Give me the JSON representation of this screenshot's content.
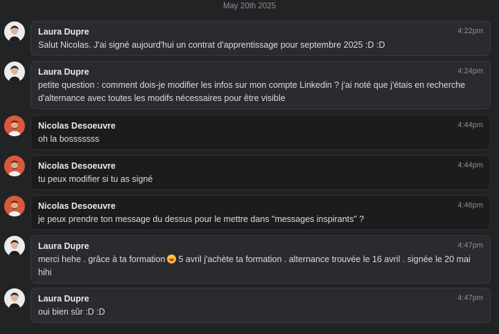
{
  "date_header": "May 20th 2025",
  "emoji": "grimacing-face-icon",
  "messages": [
    {
      "author": "Laura Dupre",
      "time": "4:22pm",
      "lines": [
        "Salut Nicolas. J'ai signé aujourd'hui un contrat d'apprentissage pour septembre 2025 :D :D"
      ]
    },
    {
      "author": "Laura Dupre",
      "time": "4:24pm",
      "lines": [
        "petite question : comment dois-je modifier les infos sur mon compte Linkedin ? j'ai noté que j'étais en recherche",
        "d'alternance avec toutes les modifs nécessaires pour être visible"
      ]
    },
    {
      "author": "Nicolas Desoeuvre",
      "time": "4:44pm",
      "lines": [
        "oh la bosssssss"
      ]
    },
    {
      "author": "Nicolas Desoeuvre",
      "time": "4:44pm",
      "lines": [
        "tu peux modifier si tu as signé"
      ]
    },
    {
      "author": "Nicolas Desoeuvre",
      "time": "4:46pm",
      "lines": [
        "je peux prendre ton message du dessus pour le mettre dans \"messages inspirants\" ?"
      ]
    },
    {
      "author": "Laura Dupre",
      "time": "4:47pm",
      "line1_before_emoji": "merci hehe . grâce à ta formation",
      "line1_after_emoji": "5 avril j'achète ta formation . alternance trouvée le 16 avril . signée le 20 mai",
      "line2": "hihi"
    },
    {
      "author": "Laura Dupre",
      "time": "4:47pm",
      "lines": [
        "oui bien sûr :D :D"
      ]
    }
  ]
}
